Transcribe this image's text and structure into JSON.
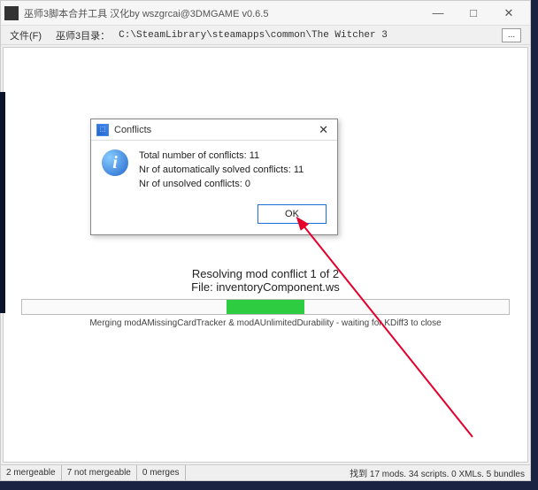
{
  "window": {
    "title": "巫师3脚本合并工具 汉化by wszgrcai@3DMGAME v0.6.5",
    "controls": {
      "min": "—",
      "max": "□",
      "close": "✕"
    }
  },
  "menubar": {
    "file": "文件(F)",
    "dir_label": "巫师3目录：",
    "path": "C:\\SteamLibrary\\steamapps\\common\\The Witcher 3",
    "browse": "..."
  },
  "progress": {
    "line1": "Resolving mod conflict 1 of 2",
    "line2": "File: inventoryComponent.ws",
    "merge_line": "Merging modAMissingCardTracker & modAUnlimitedDurability - waiting for KDiff3 to close"
  },
  "dialog": {
    "title": "Conflicts",
    "close": "✕",
    "info": "i",
    "line1": "Total number of conflicts: 11",
    "line2": "Nr of automatically solved conflicts: 11",
    "line3": "Nr of unsolved conflicts: 0",
    "ok": "OK"
  },
  "statusbar": {
    "mergeable": "2 mergeable",
    "not_mergeable": "7 not mergeable",
    "merges": "0 merges",
    "right": "找到 17 mods. 34 scripts. 0 XMLs. 5 bundles"
  }
}
